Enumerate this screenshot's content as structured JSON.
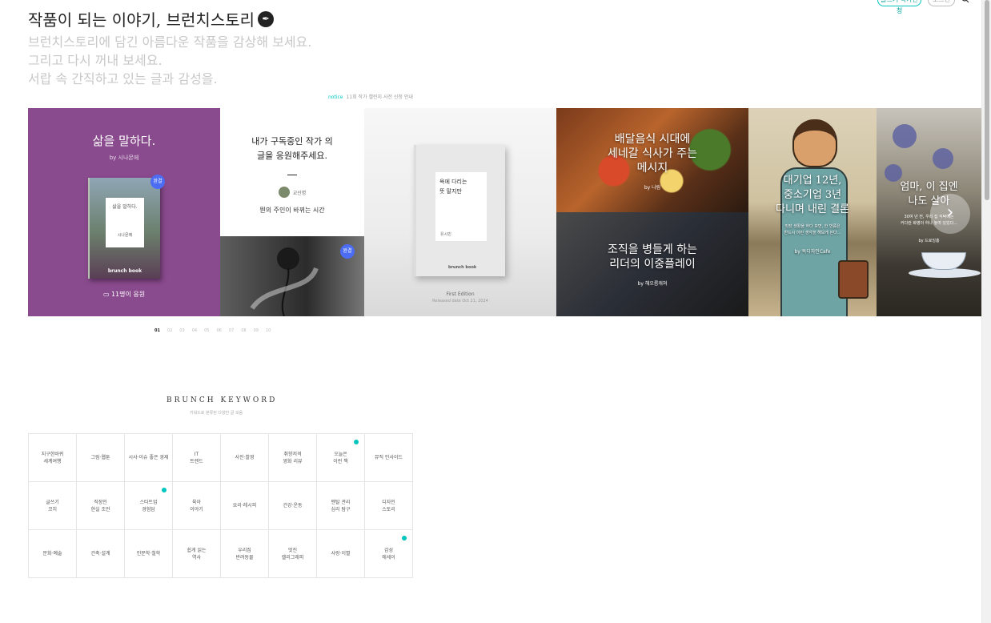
{
  "header": {
    "btn1_label": "글쓰기 작가신청",
    "btn2_label": "로그인",
    "title": "작품이 되는 이야기, 브런치스토리",
    "subtitles": [
      "브런치스토리에 담긴 아름다운 작품을 감상해 보세요.",
      "그리고 다시 꺼내 보세요.",
      "서랍 속 간직하고 있는 글과 감성을."
    ],
    "notice_tag": "notice",
    "notice_text": "11회 작가 챌린지 사전 신청 안내"
  },
  "cards": {
    "c1": {
      "title": "삶을 말하다.",
      "by": "by 시나몬에",
      "book_title": "삶을 말하다.",
      "book_author": "시나몬에",
      "brand": "brunch book",
      "badge": "완결",
      "foot": "11명이 응원"
    },
    "c2": {
      "title": "내가 구독중인 작가 의\n글을 응원해주세요.",
      "author": "교신명",
      "line": "뭔의 주인이 바뀌는 시간"
    },
    "c3": {
      "badge": "완결"
    },
    "c4": {
      "book_title": "욕에 다리는\n뜻 말지만",
      "book_author": "유시민",
      "brand": "brunch book",
      "edition": "First Edition",
      "date": "Released date Oct 21, 2024"
    },
    "c5": {
      "title": "배달음식 시대에\n세네갈 식사가 주는\n메시지",
      "by": "by 나림"
    },
    "c6": {
      "title": "조직을 병들게 하는\n리더의 이중플레이",
      "by": "by 해오름캐쳐"
    },
    "c7": {
      "title": "대기업 12년,\n중소기업 3년\n다니며 내린 결론",
      "desc": "직장 생활을 하다 보면, 한 번쯤은\n반드시 이런 생각을 해보게 된다...",
      "by": "by 독디자인Cafe"
    },
    "c8": {
      "title": "엄마, 이 집엔\n나도 살아",
      "desc": "30여 년 전, 우리 집 식탁에는\n커다란 화병이 하나 놓여 있었다...",
      "by": "by 드로잉홍"
    }
  },
  "pager": [
    "01",
    "02",
    "03",
    "04",
    "05",
    "06",
    "07",
    "08",
    "09",
    "10"
  ],
  "keyword": {
    "title": "BRUNCH KEYWORD",
    "subtitle": "키워드로 분류된 다양한 글 모음",
    "items": [
      {
        "label": "지구한바퀴\n세계여행",
        "dot": false
      },
      {
        "label": "그림·웹툰",
        "dot": false
      },
      {
        "label": "시사·이슈 좋은 경제",
        "dot": false
      },
      {
        "label": "IT\n트렌드",
        "dot": false
      },
      {
        "label": "사진·촬영",
        "dot": false
      },
      {
        "label": "취향저격\n영화 리뷰",
        "dot": false
      },
      {
        "label": "오늘은\n이런 책",
        "dot": true
      },
      {
        "label": "뮤직 인사이드",
        "dot": false
      },
      {
        "label": "글쓰기\n코치",
        "dot": false
      },
      {
        "label": "직장인\n현실 조언",
        "dot": false
      },
      {
        "label": "스타트업\n경험담",
        "dot": true
      },
      {
        "label": "육아\n이야기",
        "dot": false
      },
      {
        "label": "요리·레시피",
        "dot": false
      },
      {
        "label": "건강·운동",
        "dot": false
      },
      {
        "label": "멘탈 관리\n심리 탐구",
        "dot": false
      },
      {
        "label": "디자인\n스토리",
        "dot": false
      },
      {
        "label": "문화·예술",
        "dot": false
      },
      {
        "label": "건축·설계",
        "dot": false
      },
      {
        "label": "인문학·철학",
        "dot": false
      },
      {
        "label": "쉽게 읽는\n역사",
        "dot": false
      },
      {
        "label": "우리집\n반려동물",
        "dot": false
      },
      {
        "label": "멋진\n캘리그래피",
        "dot": false
      },
      {
        "label": "사랑·이별",
        "dot": false
      },
      {
        "label": "감성\n에세이",
        "dot": true
      }
    ]
  },
  "colors": {
    "accent": "#00c6be",
    "purple": "#8a4a8e",
    "badge": "#4b6cf3"
  }
}
